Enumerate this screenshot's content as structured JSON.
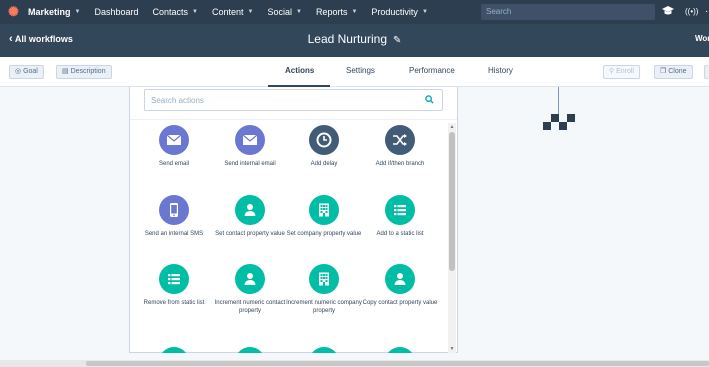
{
  "topnav": {
    "items": [
      {
        "label": "Marketing"
      },
      {
        "label": "Dashboard"
      },
      {
        "label": "Contacts"
      },
      {
        "label": "Content"
      },
      {
        "label": "Social"
      },
      {
        "label": "Reports"
      },
      {
        "label": "Productivity"
      }
    ],
    "search_placeholder": "Search"
  },
  "header": {
    "back_label": "All workflows",
    "title": "Lead Nurturing",
    "right_label": "Wor"
  },
  "toolbar": {
    "goal_label": "Goal",
    "description_label": "Description",
    "tabs": [
      {
        "label": "Actions"
      },
      {
        "label": "Settings"
      },
      {
        "label": "Performance"
      },
      {
        "label": "History"
      }
    ],
    "enroll_label": "Enroll",
    "clone_label": "Clone"
  },
  "panel": {
    "search_placeholder": "Search actions",
    "actions": [
      {
        "label": "Send email",
        "icon": "envelope-icon",
        "color": "#6a78d1"
      },
      {
        "label": "Send internal email",
        "icon": "envelope-icon",
        "color": "#6a78d1"
      },
      {
        "label": "Add delay",
        "icon": "clock-icon",
        "color": "#425b76"
      },
      {
        "label": "Add if/then branch",
        "icon": "shuffle-icon",
        "color": "#425b76"
      },
      {
        "label": "Send an internal SMS",
        "icon": "phone-icon",
        "color": "#6a78d1"
      },
      {
        "label": "Set contact property value",
        "icon": "person-icon",
        "color": "#00bda5"
      },
      {
        "label": "Set company property value",
        "icon": "building-icon",
        "color": "#00bda5"
      },
      {
        "label": "Add to a static list",
        "icon": "list-icon",
        "color": "#00bda5"
      },
      {
        "label": "Remove from static list",
        "icon": "list-icon",
        "color": "#00bda5"
      },
      {
        "label": "Increment numeric contact property",
        "icon": "person-icon",
        "color": "#00bda5"
      },
      {
        "label": "Increment numeric company property",
        "icon": "building-icon",
        "color": "#00bda5"
      },
      {
        "label": "Copy contact property value",
        "icon": "person-icon",
        "color": "#00bda5"
      }
    ]
  }
}
